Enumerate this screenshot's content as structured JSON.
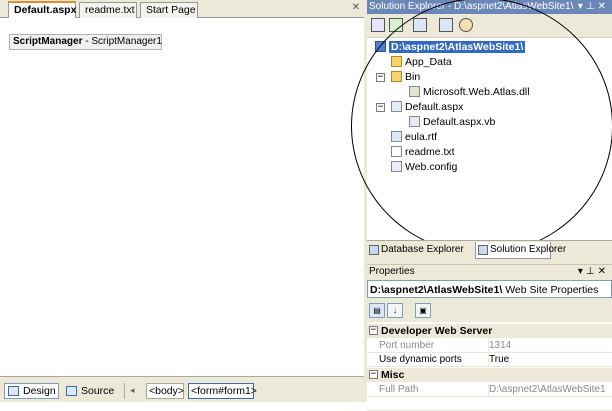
{
  "editor": {
    "tabs": [
      {
        "label": "Default.aspx",
        "active": true
      },
      {
        "label": "readme.txt",
        "active": false
      },
      {
        "label": "Start Page",
        "active": false
      }
    ],
    "close_glyph": "✕",
    "script_manager": {
      "type": "ScriptManager",
      "separator": " - ",
      "id": "ScriptManager1"
    },
    "views": {
      "design": "Design",
      "source": "Source"
    },
    "breadcrumbs": [
      "<body>",
      "<form#form1>"
    ]
  },
  "solution_explorer": {
    "title": "Solution Explorer - D:\\aspnet2\\AtlasWebSite1\\",
    "tree": {
      "root": "D:\\aspnet2\\AtlasWebSite1\\",
      "app_data": "App_Data",
      "bin": "Bin",
      "dll": "Microsoft.Web.Atlas.dll",
      "default_aspx": "Default.aspx",
      "default_vb": "Default.aspx.vb",
      "eula": "eula.rtf",
      "readme": "readme.txt",
      "webconfig": "Web.config"
    },
    "bottom_tabs": [
      "Database Explorer",
      "Solution Explorer"
    ]
  },
  "properties": {
    "title": "Properties",
    "object_name": "D:\\aspnet2\\AtlasWebSite1\\",
    "object_type": "Web Site Properties",
    "categories": [
      {
        "name": "Developer Web Server",
        "rows": [
          {
            "name": "Port number",
            "value": "1314"
          },
          {
            "name": "Use dynamic ports",
            "value": "True"
          }
        ]
      },
      {
        "name": "Misc",
        "rows": [
          {
            "name": "Full Path",
            "value": "D:\\aspnet2\\AtlasWebSite1"
          }
        ]
      }
    ]
  },
  "colors": {
    "title_bar": "#6b87b8",
    "selection": "#316ac5",
    "active_tab_accent": "#e68b2c",
    "chrome": "#ece9d8"
  },
  "icons": [
    "close-icon",
    "pin-icon",
    "dropdown-icon",
    "properties-icon",
    "refresh-icon",
    "nest-related-files-icon",
    "view-in-browser-icon",
    "copy-website-icon",
    "project-icon",
    "folder-icon",
    "dll-icon",
    "aspx-file-icon",
    "vb-file-icon",
    "rtf-file-icon",
    "txt-file-icon",
    "config-file-icon",
    "categorized-icon",
    "alphabetical-icon",
    "property-pages-icon"
  ]
}
